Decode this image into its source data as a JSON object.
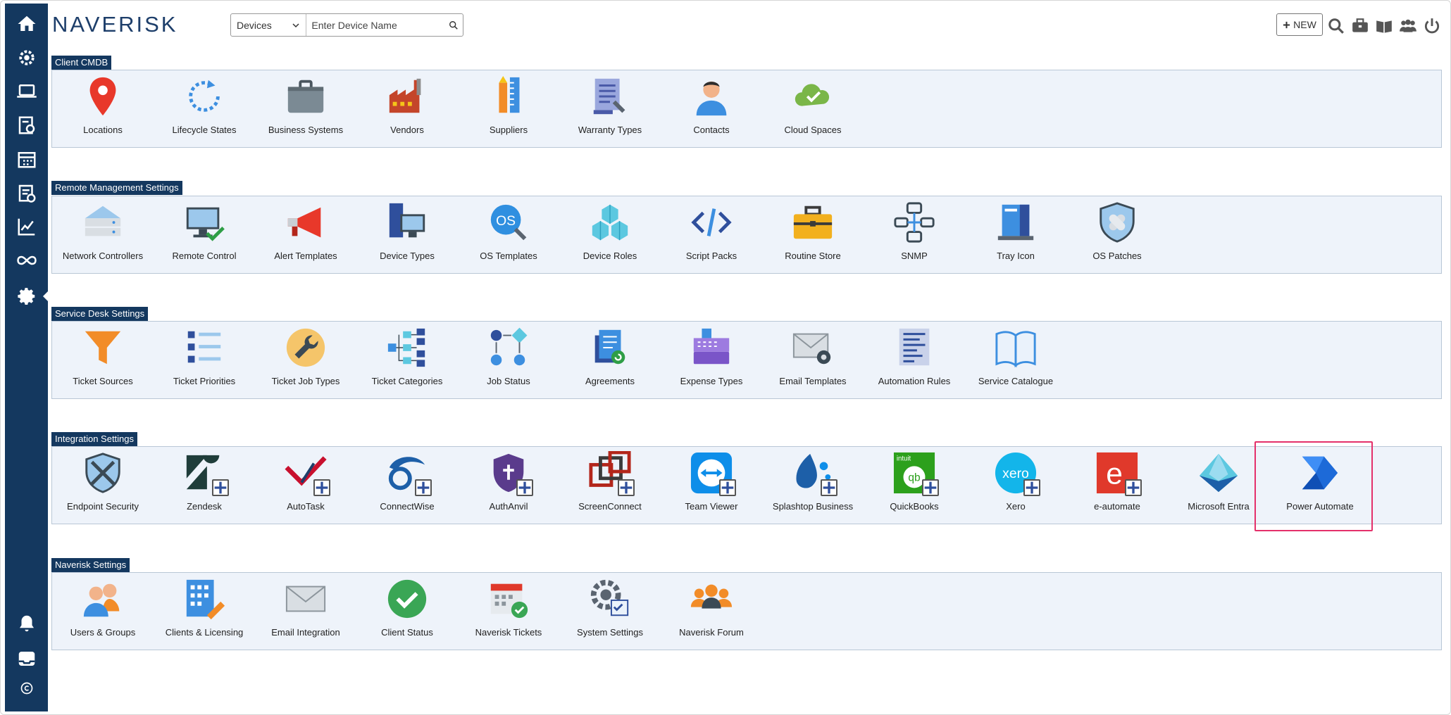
{
  "app": {
    "brand": "NAVERISK"
  },
  "search": {
    "selected_type": "Devices",
    "placeholder": "Enter Device Name"
  },
  "topbar": {
    "new_label": "NEW"
  },
  "sidebar": {
    "items": [
      "home-icon",
      "settings-cog-icon",
      "laptop-icon",
      "reports-icon",
      "calendar-icon",
      "clipboard-icon",
      "chart-icon",
      "infinity-icon",
      "gear-icon",
      "bell-icon",
      "inbox-icon",
      "copyright-icon"
    ]
  },
  "sections": [
    {
      "title": "Client CMDB",
      "items": [
        {
          "label": "Locations",
          "icon": "location-pin-icon"
        },
        {
          "label": "Lifecycle States",
          "icon": "lifecycle-icon"
        },
        {
          "label": "Business Systems",
          "icon": "briefcase-icon"
        },
        {
          "label": "Vendors",
          "icon": "factory-icon"
        },
        {
          "label": "Suppliers",
          "icon": "pencil-ruler-icon"
        },
        {
          "label": "Warranty Types",
          "icon": "warranty-icon"
        },
        {
          "label": "Contacts",
          "icon": "contact-person-icon"
        },
        {
          "label": "Cloud Spaces",
          "icon": "cloud-check-icon"
        }
      ]
    },
    {
      "title": "Remote Management Settings",
      "items": [
        {
          "label": "Network Controllers",
          "icon": "network-controller-icon"
        },
        {
          "label": "Remote Control",
          "icon": "monitor-check-icon"
        },
        {
          "label": "Alert Templates",
          "icon": "megaphone-icon"
        },
        {
          "label": "Device Types",
          "icon": "device-types-icon"
        },
        {
          "label": "OS Templates",
          "icon": "os-templates-icon"
        },
        {
          "label": "Device Roles",
          "icon": "cubes-icon"
        },
        {
          "label": "Script Packs",
          "icon": "code-icon"
        },
        {
          "label": "Routine Store",
          "icon": "toolbox-icon"
        },
        {
          "label": "SNMP",
          "icon": "snmp-icon"
        },
        {
          "label": "Tray Icon",
          "icon": "tray-icon"
        },
        {
          "label": "OS Patches",
          "icon": "shield-bandage-icon"
        }
      ]
    },
    {
      "title": "Service Desk Settings",
      "items": [
        {
          "label": "Ticket Sources",
          "icon": "funnel-icon"
        },
        {
          "label": "Ticket Priorities",
          "icon": "list-icon"
        },
        {
          "label": "Ticket Job Types",
          "icon": "wrench-icon"
        },
        {
          "label": "Ticket Categories",
          "icon": "hierarchy-icon"
        },
        {
          "label": "Job Status",
          "icon": "flow-icon"
        },
        {
          "label": "Agreements",
          "icon": "agreement-icon"
        },
        {
          "label": "Expense Types",
          "icon": "cash-register-icon"
        },
        {
          "label": "Email Templates",
          "icon": "email-gear-icon"
        },
        {
          "label": "Automation Rules",
          "icon": "rules-doc-icon"
        },
        {
          "label": "Service Catalogue",
          "icon": "book-icon"
        }
      ]
    },
    {
      "title": "Integration Settings",
      "items": [
        {
          "label": "Endpoint Security",
          "icon": "shield-swords-icon"
        },
        {
          "label": "Zendesk",
          "icon": "zendesk-icon"
        },
        {
          "label": "AutoTask",
          "icon": "autotask-icon"
        },
        {
          "label": "ConnectWise",
          "icon": "connectwise-icon"
        },
        {
          "label": "AuthAnvil",
          "icon": "authanvil-icon"
        },
        {
          "label": "ScreenConnect",
          "icon": "screenconnect-icon"
        },
        {
          "label": "Team Viewer",
          "icon": "teamviewer-icon"
        },
        {
          "label": "Splashtop Business",
          "icon": "splashtop-icon"
        },
        {
          "label": "QuickBooks",
          "icon": "quickbooks-icon",
          "badge": "intuit"
        },
        {
          "label": "Xero",
          "icon": "xero-icon",
          "badge": "xero"
        },
        {
          "label": "e-automate",
          "icon": "e-automate-icon",
          "badge": "e"
        },
        {
          "label": "Microsoft Entra",
          "icon": "microsoft-entra-icon"
        },
        {
          "label": "Power Automate",
          "icon": "power-automate-icon"
        }
      ]
    },
    {
      "title": "Naverisk Settings",
      "items": [
        {
          "label": "Users & Groups",
          "icon": "users-icon"
        },
        {
          "label": "Clients & Licensing",
          "icon": "building-pencil-icon"
        },
        {
          "label": "Email Integration",
          "icon": "envelope-icon"
        },
        {
          "label": "Client Status",
          "icon": "check-circle-icon"
        },
        {
          "label": "Naverisk Tickets",
          "icon": "calendar-check-icon"
        },
        {
          "label": "System Settings",
          "icon": "gear-calendar-icon"
        },
        {
          "label": "Naverisk Forum",
          "icon": "forum-people-icon"
        }
      ]
    }
  ]
}
